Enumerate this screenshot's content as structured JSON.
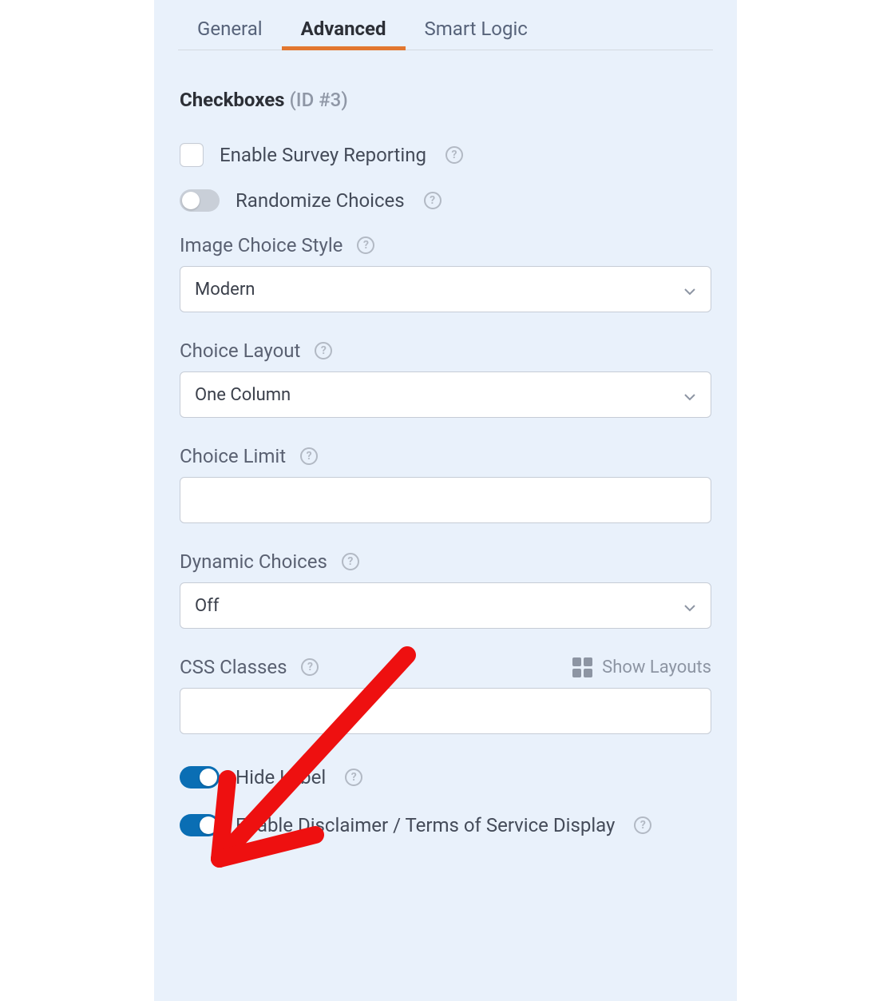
{
  "tabs": {
    "general": "General",
    "advanced": "Advanced",
    "smart_logic": "Smart Logic",
    "active": "advanced"
  },
  "section": {
    "title": "Checkboxes",
    "id_text": "(ID #3)"
  },
  "options": {
    "enable_survey_reporting": "Enable Survey Reporting",
    "randomize_choices": "Randomize Choices",
    "hide_label": "Hide Label",
    "enable_disclaimer": "Enable Disclaimer / Terms of Service Display"
  },
  "fields": {
    "image_choice_style": {
      "label": "Image Choice Style",
      "value": "Modern"
    },
    "choice_layout": {
      "label": "Choice Layout",
      "value": "One Column"
    },
    "choice_limit": {
      "label": "Choice Limit",
      "value": ""
    },
    "dynamic_choices": {
      "label": "Dynamic Choices",
      "value": "Off"
    },
    "css_classes": {
      "label": "CSS Classes",
      "value": "",
      "show_layouts": "Show Layouts"
    }
  },
  "icons": {
    "help": "?"
  }
}
